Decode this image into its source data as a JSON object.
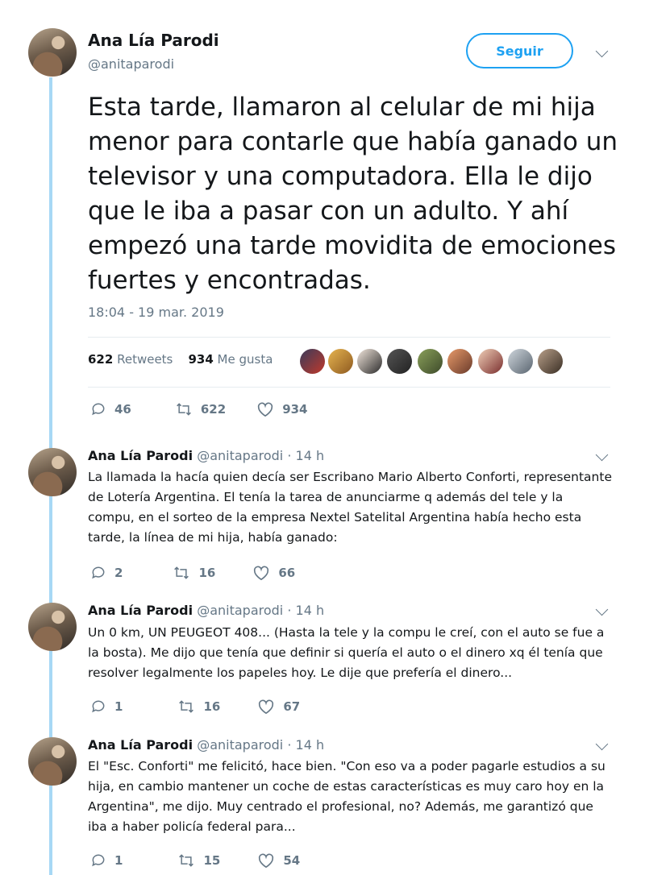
{
  "main_tweet": {
    "name": "Ana Lía Parodi",
    "handle": "@anitaparodi",
    "follow_label": "Seguir",
    "text": "Esta tarde, llamaron al celular de mi hija menor para contarle que había ganado un televisor y una computadora. Ella le dijo que le iba a pasar con un adulto. Y ahí empezó una tarde movidita de emociones fuertes y encontradas.",
    "timestamp": "18:04 - 19 mar. 2019",
    "retweets_count": "622",
    "retweets_label": "Retweets",
    "likes_count": "934",
    "likes_label": "Me gusta",
    "actions": {
      "replies": "46",
      "retweets": "622",
      "likes": "934"
    }
  },
  "replies": [
    {
      "name": "Ana Lía Parodi",
      "handle_time": "@anitaparodi · 14 h",
      "text": "La llamada la hacía quien decía ser Escribano Mario Alberto Conforti, representante de Lotería Argentina. El tenía la tarea de anunciarme q además del tele y la compu, en el sorteo de la empresa Nextel Satelital Argentina había hecho esta tarde, la línea de mi hija, había ganado:",
      "replies": "2",
      "retweets": "16",
      "likes": "66"
    },
    {
      "name": "Ana Lía Parodi",
      "handle_time": "@anitaparodi · 14 h",
      "text": "Un 0 km, UN PEUGEOT 408... (Hasta la tele y la compu le creí, con el auto se fue a la bosta). Me dijo que tenía que definir si quería el auto o el dinero xq él tenía que resolver legalmente los papeles hoy. Le dije que prefería el dinero...",
      "replies": "1",
      "retweets": "16",
      "likes": "67"
    },
    {
      "name": "Ana Lía Parodi",
      "handle_time": "@anitaparodi · 14 h",
      "text": "El \"Esc. Conforti\" me felicitó, hace bien. \"Con eso va a poder pagarle estudios a su hija, en cambio mantener un coche de estas características es muy caro hoy en la Argentina\", me dijo. Muy centrado el profesional, no? Además, me garantizó que iba a haber policía federal para...",
      "replies": "1",
      "retweets": "15",
      "likes": "54"
    }
  ],
  "colors": {
    "accent": "#1da1f2",
    "muted": "#657786",
    "thread": "#a7d8f5"
  }
}
